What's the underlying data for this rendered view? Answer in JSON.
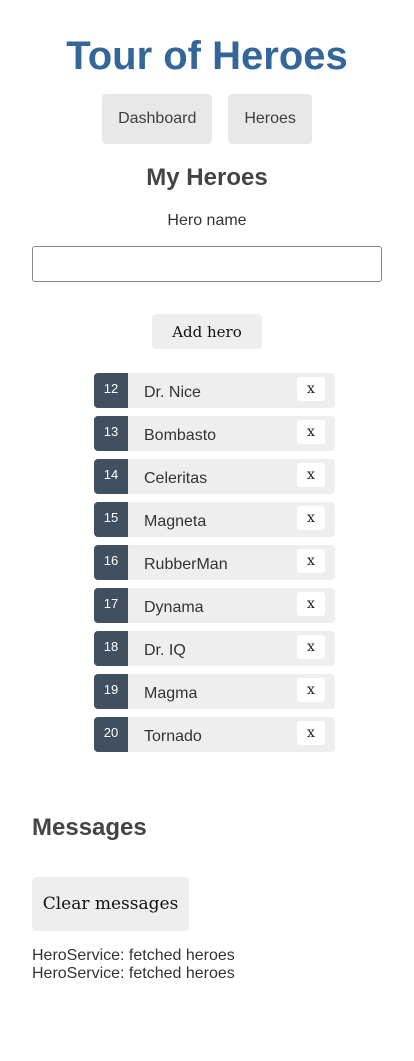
{
  "app": {
    "title": "Tour of Heroes"
  },
  "nav": {
    "items": [
      {
        "label": "Dashboard"
      },
      {
        "label": "Heroes"
      }
    ]
  },
  "heroes_page": {
    "title": "My Heroes",
    "input_label": "Hero name",
    "input_value": "",
    "add_button_label": "Add hero",
    "heroes": [
      {
        "id": "12",
        "name": "Dr. Nice",
        "delete_label": "x"
      },
      {
        "id": "13",
        "name": "Bombasto",
        "delete_label": "x"
      },
      {
        "id": "14",
        "name": "Celeritas",
        "delete_label": "x"
      },
      {
        "id": "15",
        "name": "Magneta",
        "delete_label": "x"
      },
      {
        "id": "16",
        "name": "RubberMan",
        "delete_label": "x"
      },
      {
        "id": "17",
        "name": "Dynama",
        "delete_label": "x"
      },
      {
        "id": "18",
        "name": "Dr. IQ",
        "delete_label": "x"
      },
      {
        "id": "19",
        "name": "Magma",
        "delete_label": "x"
      },
      {
        "id": "20",
        "name": "Tornado",
        "delete_label": "x"
      }
    ]
  },
  "messages": {
    "title": "Messages",
    "clear_button_label": "Clear messages",
    "items": [
      "HeroService: fetched heroes",
      "HeroService: fetched heroes"
    ]
  },
  "colors": {
    "title": "#336699",
    "badge": "#405061",
    "item_background": "#eeeeee",
    "nav_background": "#e8e8e8"
  }
}
